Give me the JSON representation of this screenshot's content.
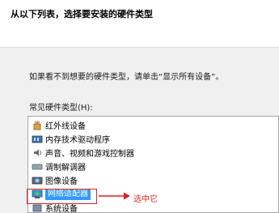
{
  "header": {
    "title": "从以下列表，选择要安装的硬件类型"
  },
  "instruction": "如果看不到想要的硬件类型，请单击“显示所有设备”。",
  "list": {
    "label": "常见硬件类型(H):",
    "items": [
      {
        "label": "红外线设备",
        "icon": "infrared-device-icon"
      },
      {
        "label": "内存技术驱动程序",
        "icon": "memory-tech-driver-icon"
      },
      {
        "label": "声音、视频和游戏控制器",
        "icon": "sound-video-game-icon"
      },
      {
        "label": "调制解调器",
        "icon": "modem-icon"
      },
      {
        "label": "图像设备",
        "icon": "imaging-device-icon"
      },
      {
        "label": "网络适配器",
        "icon": "network-adapter-icon",
        "selected": true
      },
      {
        "label": "系统设备",
        "icon": "system-device-icon"
      }
    ]
  },
  "annotation": {
    "text": "选中它",
    "color": "#e02020"
  },
  "colors": {
    "selection": "#3399ff",
    "annotation": "#e02020"
  }
}
